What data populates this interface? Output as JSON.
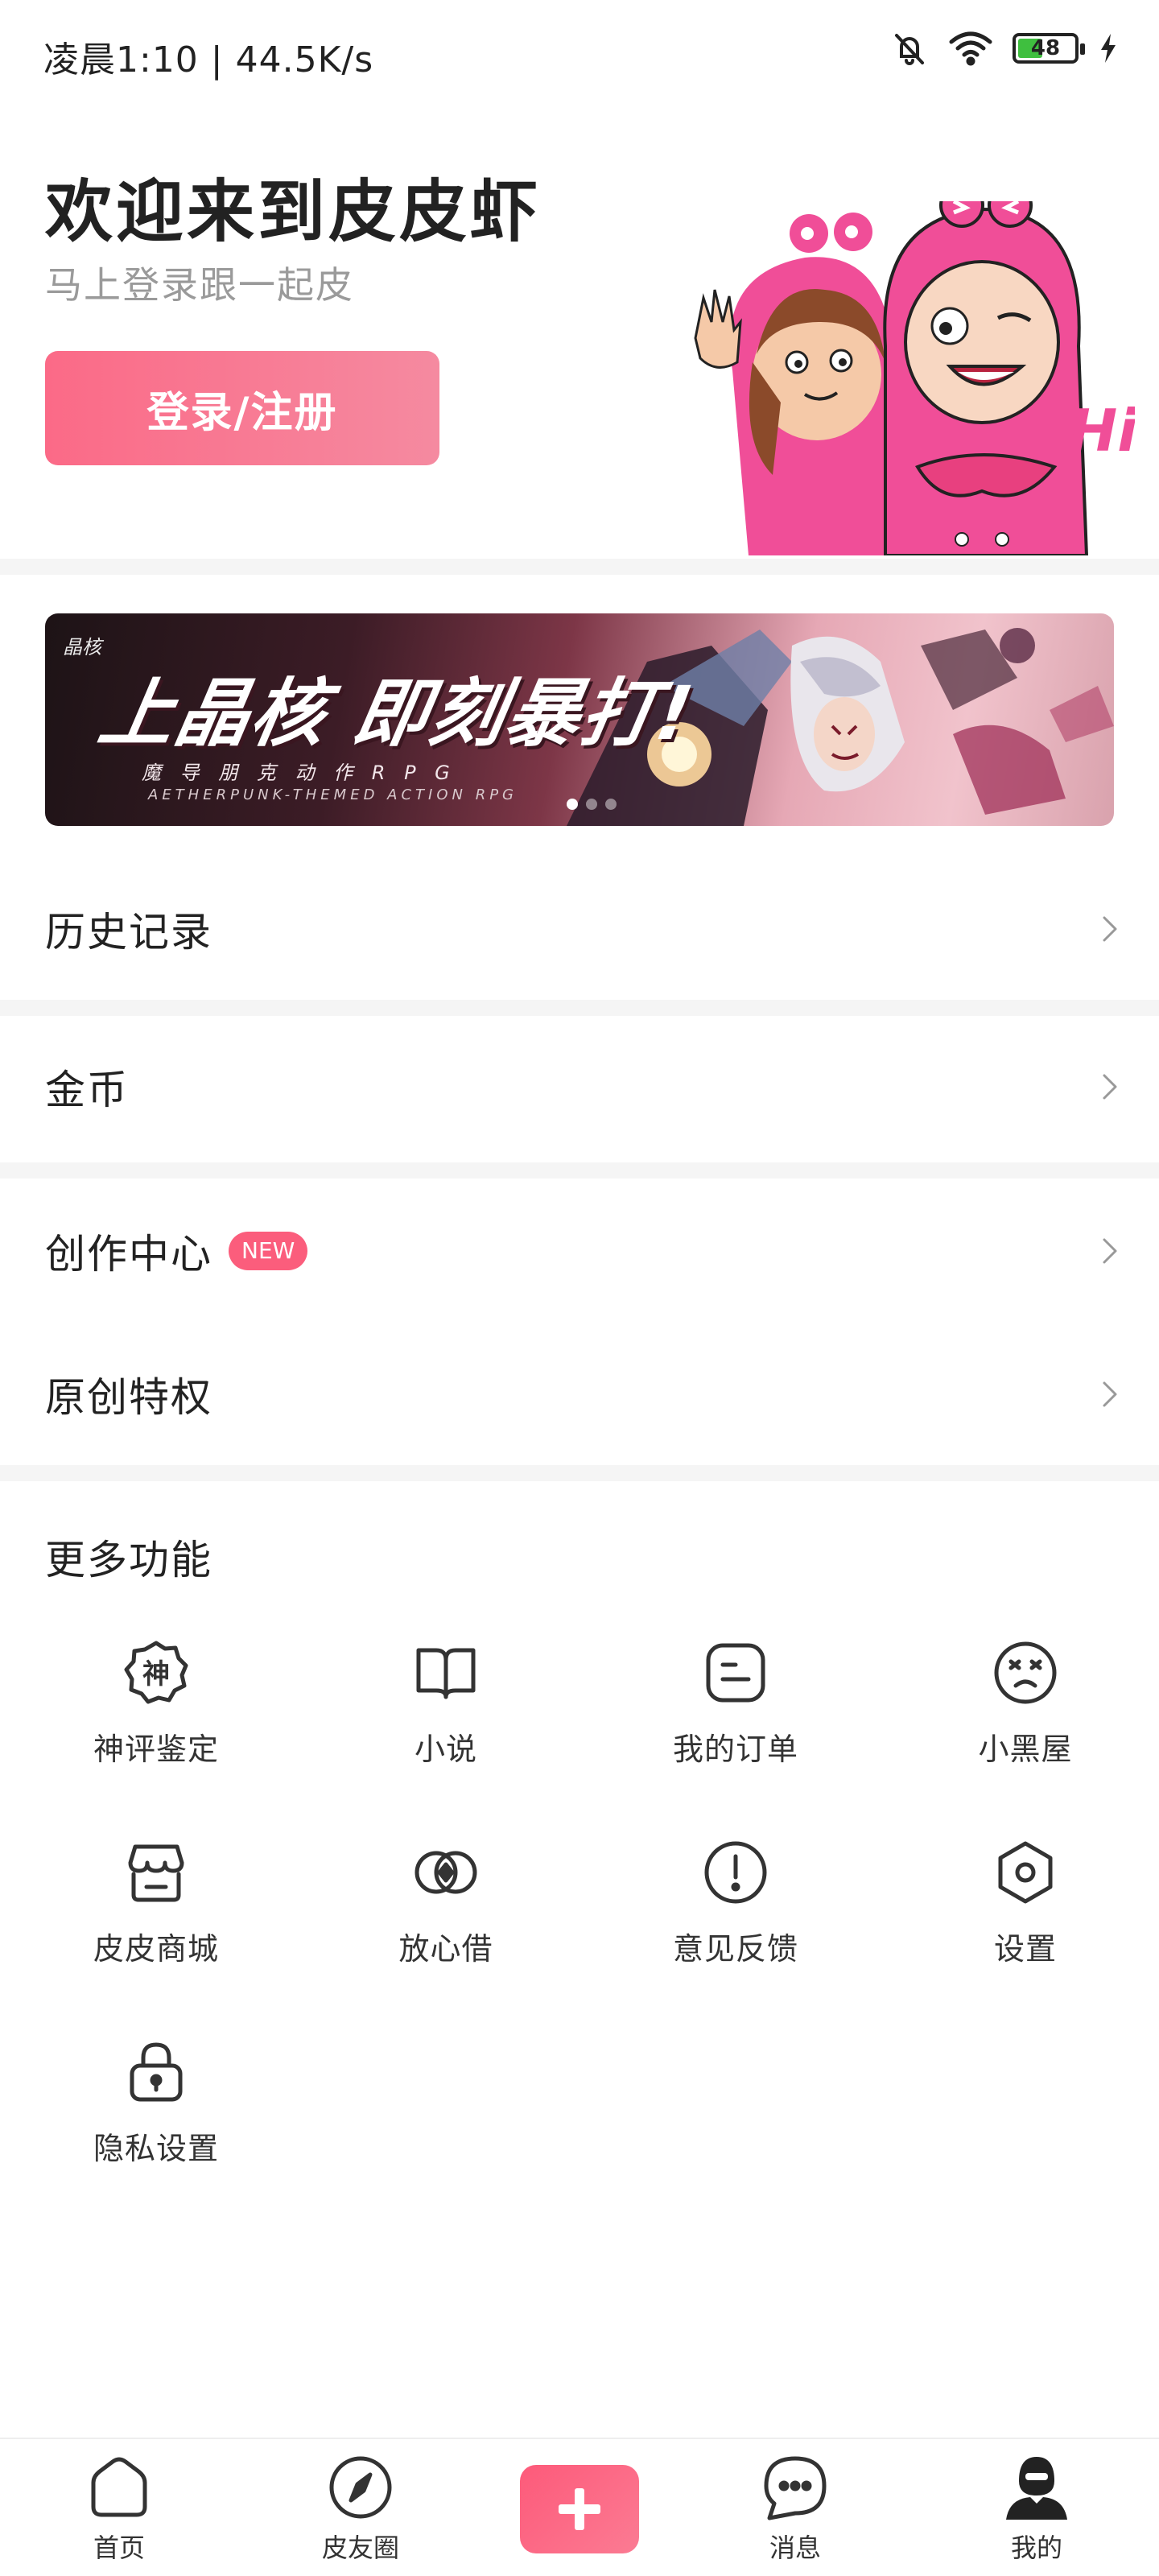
{
  "status_bar": {
    "time_speed": "凌晨1:10 | 44.5K/s",
    "battery_level": "48",
    "battery_percent": 48,
    "icons": [
      "bell-muted-icon",
      "wifi-icon",
      "battery-icon",
      "charging-bolt-icon"
    ]
  },
  "header": {
    "title": "欢迎来到皮皮虾",
    "subtitle": "马上登录跟一起皮",
    "login_button": "登录/注册",
    "mascot_text": "Hi"
  },
  "banner": {
    "logo_text": "晶核",
    "headline": "上晶核 即刻暴打!",
    "line1": "魔 导 朋 克 动 作 R P G",
    "line2": "AETHERPUNK-THEMED ACTION RPG",
    "dots": 3,
    "active_dot": 1
  },
  "menu": {
    "history": "历史记录",
    "coins": "金币",
    "creation_center": "创作中心",
    "new_badge": "NEW",
    "original_privilege": "原创特权"
  },
  "more_features": {
    "title": "更多功能",
    "items": [
      {
        "label": "神评鉴定",
        "icon": "shen-badge-icon",
        "glyph": "神"
      },
      {
        "label": "小说",
        "icon": "book-icon"
      },
      {
        "label": "我的订单",
        "icon": "order-icon"
      },
      {
        "label": "小黑屋",
        "icon": "dizzy-face-icon"
      },
      {
        "label": "皮皮商城",
        "icon": "shop-icon"
      },
      {
        "label": "放心借",
        "icon": "loan-icon"
      },
      {
        "label": "意见反馈",
        "icon": "feedback-icon"
      },
      {
        "label": "设置",
        "icon": "settings-icon"
      },
      {
        "label": "隐私设置",
        "icon": "lock-icon"
      }
    ]
  },
  "bottom_nav": {
    "home": "首页",
    "circle": "皮友圈",
    "messages": "消息",
    "mine": "我的",
    "active": "mine"
  },
  "colors": {
    "accent": "#fb6a87",
    "text": "#222222",
    "subtext": "#9a9a9a",
    "separator": "#f5f5f5"
  }
}
